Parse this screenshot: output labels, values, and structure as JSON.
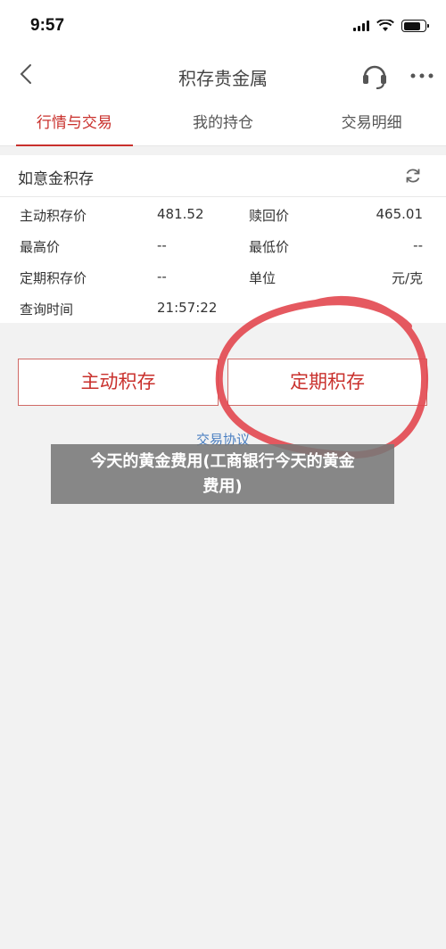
{
  "status": {
    "time": "9:57"
  },
  "nav": {
    "title": "积存贵金属"
  },
  "tabs": [
    {
      "label": "行情与交易",
      "active": true
    },
    {
      "label": "我的持仓",
      "active": false
    },
    {
      "label": "交易明细",
      "active": false
    }
  ],
  "card": {
    "title": "如意金积存",
    "rows": [
      {
        "l1": "主动积存价",
        "v1": "481.52",
        "l2": "赎回价",
        "v2": "465.01"
      },
      {
        "l1": "最高价",
        "v1": "--",
        "l2": "最低价",
        "v2": "--"
      },
      {
        "l1": "定期积存价",
        "v1": "--",
        "l2": "单位",
        "v2": "元/克"
      },
      {
        "l1": "查询时间",
        "v1": "21:57:22",
        "l2": "",
        "v2": ""
      }
    ]
  },
  "buttons": {
    "active_save": "主动积存",
    "scheduled_save": "定期积存"
  },
  "link": {
    "agreement": "交易协议"
  },
  "overlay": {
    "line1": "今天的黄金费用(工商银行今天的黄金",
    "line2": "费用)"
  },
  "colors": {
    "accent": "#c9302c",
    "link": "#4a7fc1",
    "annotation": "#e2474f"
  }
}
